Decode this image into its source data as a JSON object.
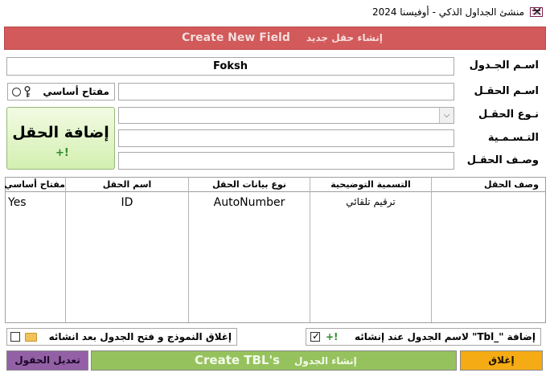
{
  "window": {
    "title": "منشئ الجداول الذكي - أوفيسنا 2024"
  },
  "header": {
    "title_en": "Create New Field",
    "title_ar": "إنشاء حقل جديد"
  },
  "form": {
    "table_name_label": "اسـم الجـدول",
    "table_name_value": "Foksh",
    "field_name_label": "اسـم الحقـل",
    "field_name_value": "",
    "field_type_label": "نـوع الحقـل",
    "field_type_value": "",
    "caption_label": "التـسـمـية",
    "caption_value": "",
    "description_label": "وصـف الحقـل",
    "description_value": "",
    "primary_key_label": "مفتاح أساسي",
    "add_field_label": "إضافة الحقل",
    "add_field_icon": "+!"
  },
  "grid": {
    "headers": {
      "description": "وصف الحقل",
      "caption": "التسمية التوضيحية",
      "data_type": "نوع بيانات الحقل",
      "field_name": "اسم الحقل",
      "primary_key": "مفتاح أساسي"
    },
    "rows": [
      {
        "primary_key": "Yes",
        "field_name": "ID",
        "data_type": "AutoNumber",
        "caption": "ترقيم تلقائي",
        "description": ""
      }
    ]
  },
  "options": {
    "add_prefix_label": "إضافة \"_Tbl\" لاسم الجدول عند إنشائه",
    "add_prefix_checked": "✓",
    "add_prefix_icon": "+!",
    "close_open_label": "إغلاق النموذج و فتح الجدول بعد انشائه"
  },
  "footer": {
    "edit_fields_label": "تعديل الحقول",
    "create_en": "Create TBL's",
    "create_ar": "إنشاء الجدول",
    "close_label": "إغلاق"
  },
  "icons": {
    "close": "✕",
    "dropdown": "⌵"
  },
  "colors": {
    "header": "#d35a5a",
    "add_button": "#d3efb0",
    "edit_button": "#9360a6",
    "create_button": "#96c25e",
    "close_button": "#f5ab14"
  }
}
